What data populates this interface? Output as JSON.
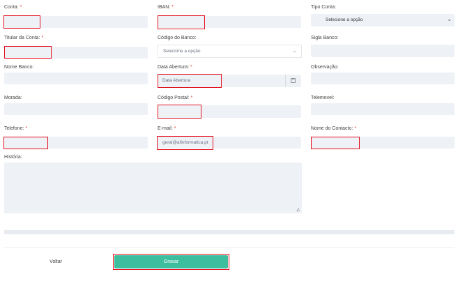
{
  "form": {
    "conta": {
      "label": "Conta: ",
      "req": "*"
    },
    "iban": {
      "label": "IBAN: ",
      "req": "*"
    },
    "tipo_conta": {
      "label": "Tipo Conta:",
      "value": "Selecione a opção"
    },
    "titular": {
      "label": "Titular da Conta: ",
      "req": "*"
    },
    "codigo_banco": {
      "label": "Código do Banco:",
      "value": "Selecione a opção"
    },
    "sigla_banco": {
      "label": "Sigla Banco:"
    },
    "nome_banco": {
      "label": "Nome Banco:"
    },
    "data_abertura": {
      "label": "Data Abertura: ",
      "req": "*",
      "placeholder": "Data Abertura"
    },
    "observacao": {
      "label": "Observação:"
    },
    "morada": {
      "label": "Morada:"
    },
    "codigo_postal": {
      "label": "Código Postal: ",
      "req": "*"
    },
    "telemovel": {
      "label": "Telemovel:"
    },
    "telefone": {
      "label": "Telefone: ",
      "req": "*"
    },
    "email": {
      "label": "E-mail: ",
      "req": "*",
      "placeholder": "geral@afinformatica.pt"
    },
    "nome_contacto": {
      "label": "Nome do Contacto: ",
      "req": "*"
    },
    "historia": {
      "label": "História:"
    }
  },
  "buttons": {
    "voltar": "Voltar",
    "gravar": "Gravar"
  },
  "colors": {
    "accent": "#3dbf9f",
    "highlight": "#e3101e",
    "field_bg": "#eef2f6"
  }
}
